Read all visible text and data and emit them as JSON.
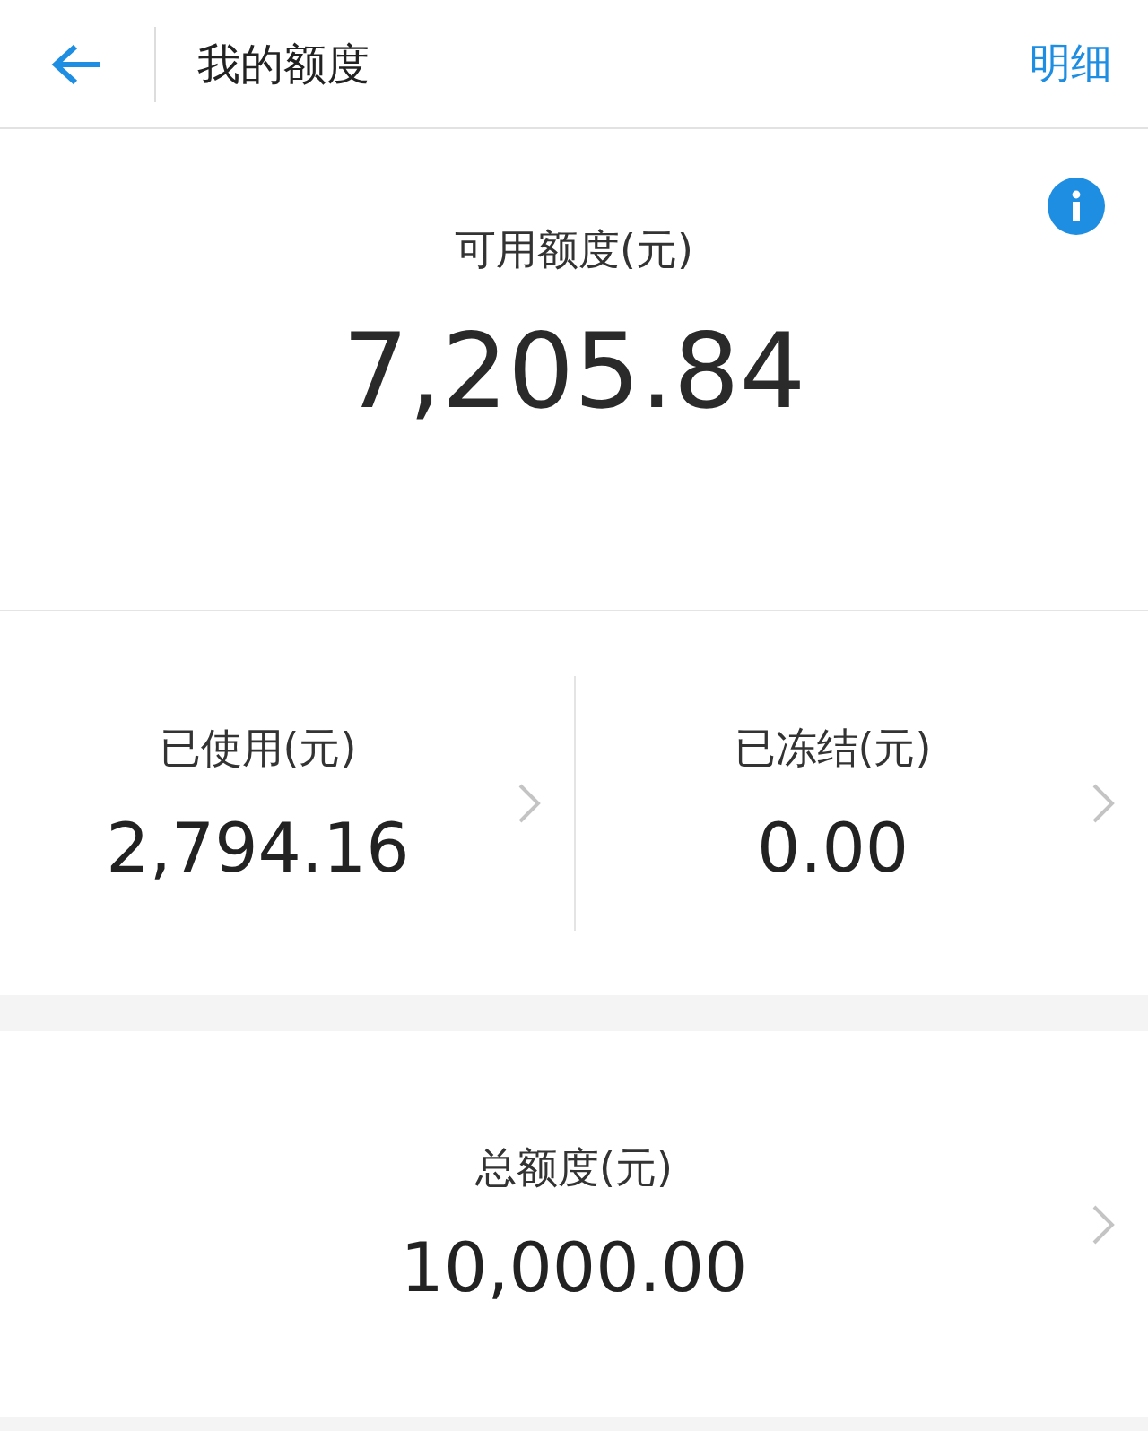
{
  "header": {
    "title": "我的额度",
    "action": "明细"
  },
  "available": {
    "label": "可用额度(元)",
    "amount": "7,205.84"
  },
  "stats": [
    {
      "label": "已使用(元)",
      "amount": "2,794.16"
    },
    {
      "label": "已冻结(元)",
      "amount": "0.00"
    }
  ],
  "total": {
    "label": "总额度(元)",
    "amount": "10,000.00"
  }
}
